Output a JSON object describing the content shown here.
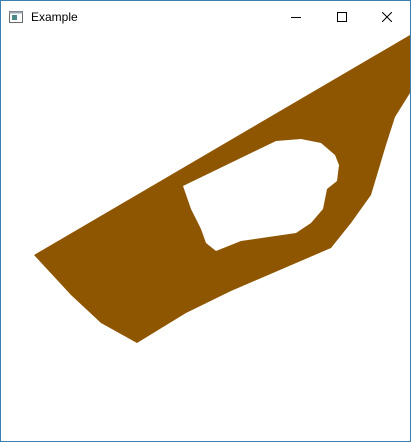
{
  "window": {
    "title": "Example",
    "app_icon": "window-app-icon",
    "controls": {
      "minimize_icon": "minimize-icon",
      "maximize_icon": "maximize-icon",
      "close_icon": "close-icon"
    }
  },
  "canvas": {
    "background": "#ffffff",
    "shape_fill": "#8f5601",
    "shape": "filled-polygon-with-hole"
  }
}
